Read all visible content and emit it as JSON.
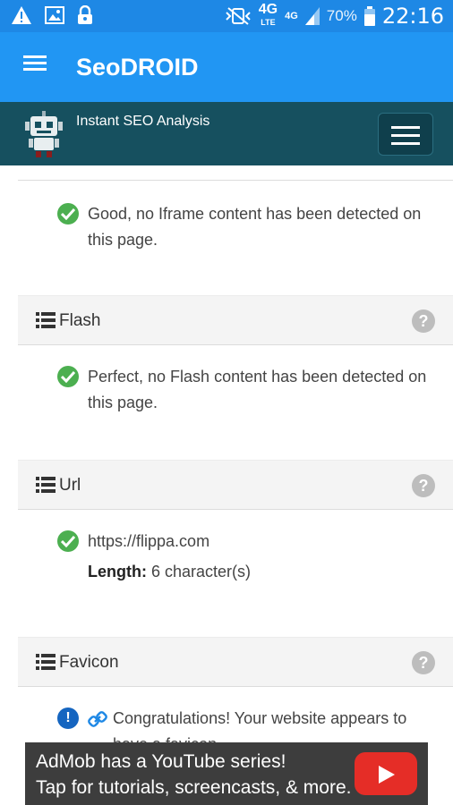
{
  "status_bar": {
    "network_label": "4G",
    "network_sub": "LTE",
    "signal_label": "4G",
    "battery": "70%",
    "time": "22:16"
  },
  "app_bar": {
    "title": "SeoDROID"
  },
  "site_header": {
    "tagline": "Instant SEO Analysis"
  },
  "iframe_section": {
    "message": "Good, no Iframe content has been detected on this page."
  },
  "flash_section": {
    "title": "Flash",
    "message": "Perfect, no Flash content has been detected on this page."
  },
  "url_section": {
    "title": "Url",
    "url": "https://flippa.com",
    "length_label": "Length:",
    "length_value": "6 character(s)"
  },
  "favicon_section": {
    "title": "Favicon",
    "message": "Congratulations! Your website appears to have a favicon."
  },
  "ad": {
    "line1": "AdMob has a YouTube series!",
    "line2": "Tap for tutorials, screencasts, & more."
  },
  "colors": {
    "status_bar": "#1e88e5",
    "app_bar": "#2196f3",
    "site_header": "#16505f",
    "success": "#4caf50",
    "info": "#1565c0",
    "help": "#bdbdbd",
    "ad_bg": "#3d3d3d",
    "youtube": "#e52d27"
  },
  "icons": [
    "warning-icon",
    "image-icon",
    "lock-icon",
    "vibrate-icon",
    "signal-icon",
    "battery-icon",
    "menu-icon",
    "robot-logo",
    "list-icon",
    "help-icon",
    "check-icon",
    "info-icon",
    "link-icon",
    "youtube-icon"
  ]
}
